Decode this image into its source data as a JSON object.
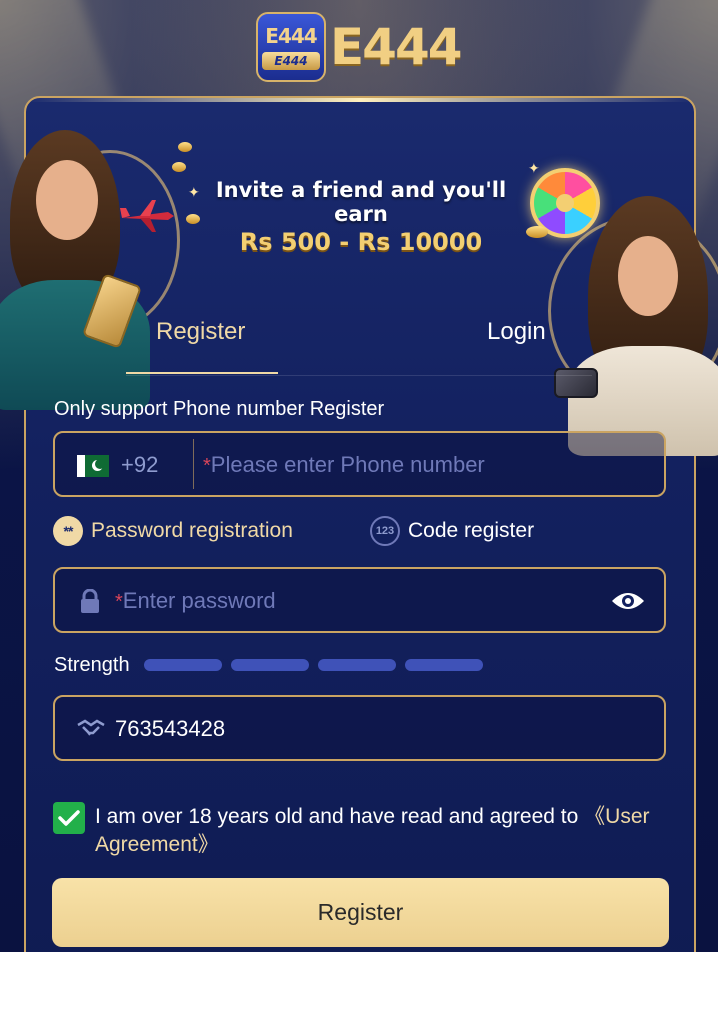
{
  "brand": {
    "badge_top": "E444",
    "badge_bottom": "E444",
    "wordmark": "E444",
    "gold": "#f1cf83",
    "navy": "#0e1a52"
  },
  "promo": {
    "line1": "Invite a friend and you'll earn",
    "line2": "Rs 500 - Rs 10000"
  },
  "tabs": [
    {
      "label": "Register",
      "active": true
    },
    {
      "label": "Login",
      "active": false
    }
  ],
  "form": {
    "note": "Only support Phone number Register",
    "phone": {
      "country_code": "+92",
      "required_mark": "*",
      "placeholder": "Please enter Phone number",
      "flag_icon": "pakistan-flag-icon"
    },
    "modes": {
      "password": {
        "label": "Password registration",
        "icon_text": "**",
        "selected": true
      },
      "code": {
        "label": "Code register",
        "icon_text": "123",
        "selected": false
      }
    },
    "password": {
      "required_mark": "*",
      "placeholder": "Enter password",
      "lock_icon": "lock-icon",
      "eye_icon": "eye-icon"
    },
    "strength": {
      "label": "Strength",
      "segments": 4,
      "segment_color": "#3f52b8"
    },
    "invite_code": {
      "value": "763543428",
      "icon": "handshake-icon"
    },
    "agreement": {
      "checked": true,
      "text": "I am over 18 years old and have read and agreed to ",
      "link": "《User Agreement》"
    },
    "submit_label": "Register"
  }
}
